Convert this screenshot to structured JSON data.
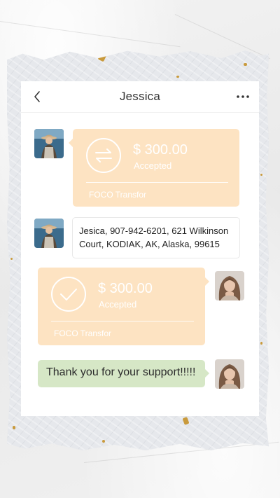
{
  "header": {
    "title": "Jessica"
  },
  "icons": {
    "back": "chevron-left-icon",
    "more": "more-horizontal-icon",
    "transfer": "transfer-arrows-icon",
    "accepted": "checkmark-circle-icon"
  },
  "colors": {
    "transfer_bubble": "#fde3c2",
    "text_bubble": "#ffffff",
    "reply_bubble": "#d6e7c6",
    "accent_gold": "#c99a3c"
  },
  "messages": [
    {
      "sender": "contact",
      "type": "transfer",
      "amount": "$ 300.00",
      "status": "Accepted",
      "label": "FOCO Transfor"
    },
    {
      "sender": "contact",
      "type": "text",
      "text": "Jesica, 907-942-6201, 621 Wilkinson Court, KODIAK, AK, Alaska, 99615"
    },
    {
      "sender": "self",
      "type": "transfer",
      "amount": "$ 300.00",
      "status": "Accepted",
      "label": "FOCO Transfor"
    },
    {
      "sender": "self",
      "type": "text",
      "text": "Thank you for your support!!!!!"
    }
  ]
}
